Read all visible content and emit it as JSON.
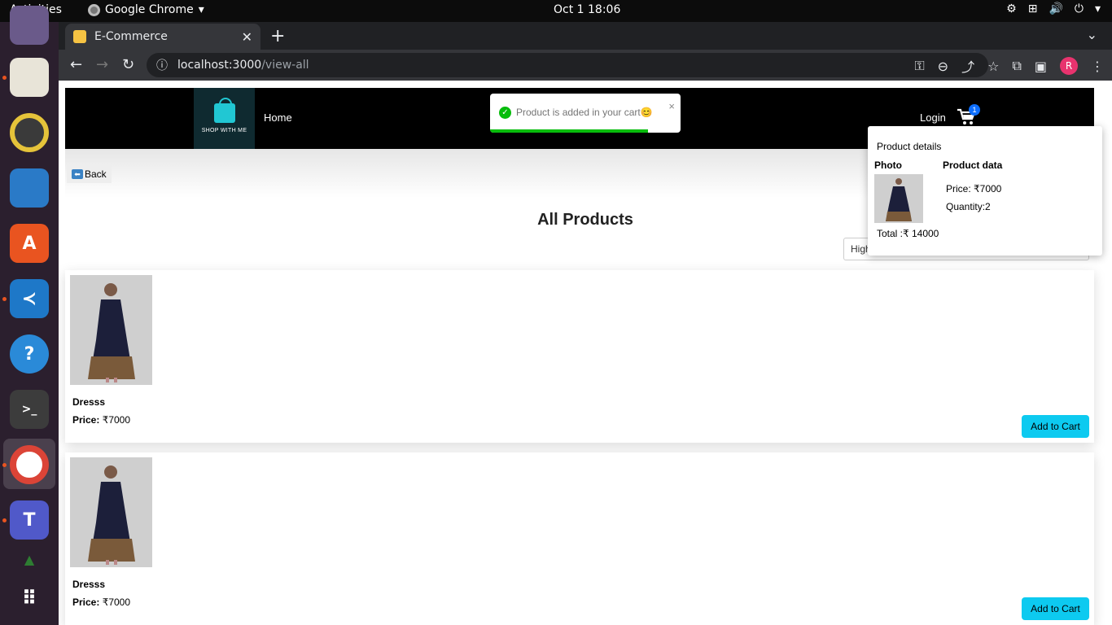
{
  "os": {
    "activities": "Activities",
    "app_name": "Google Chrome",
    "clock": "Oct 1  18:06"
  },
  "browser": {
    "tab_title": "E-Commerce",
    "url_host": "localhost:3000",
    "url_path": "/view-all",
    "profile_initial": "R"
  },
  "site": {
    "logo_text": "SHOP WITH ME",
    "nav_home": "Home",
    "nav_login": "Login",
    "cart_count": "1",
    "back_label": "Back",
    "heading": "All Products",
    "sort_value": "High"
  },
  "toast": {
    "message": "Product is added in your cart😊",
    "close": "×",
    "progress_fraction": 0.83
  },
  "products": [
    {
      "name": "Dresss",
      "price_label": "Price:",
      "price": "₹7000",
      "button": "Add to Cart"
    },
    {
      "name": "Dresss",
      "price_label": "Price:",
      "price": "₹7000",
      "button": "Add to Cart"
    }
  ],
  "cart_popup": {
    "title": "Product details",
    "photo_header": "Photo",
    "data_header": "Product data",
    "price": "Price: ₹7000",
    "quantity": "Quantity:2",
    "total": "Total :₹ 14000"
  },
  "colors": {
    "accent_button": "#0dcaf0",
    "toast_success": "#07bc0c",
    "navbar": "#000000"
  }
}
